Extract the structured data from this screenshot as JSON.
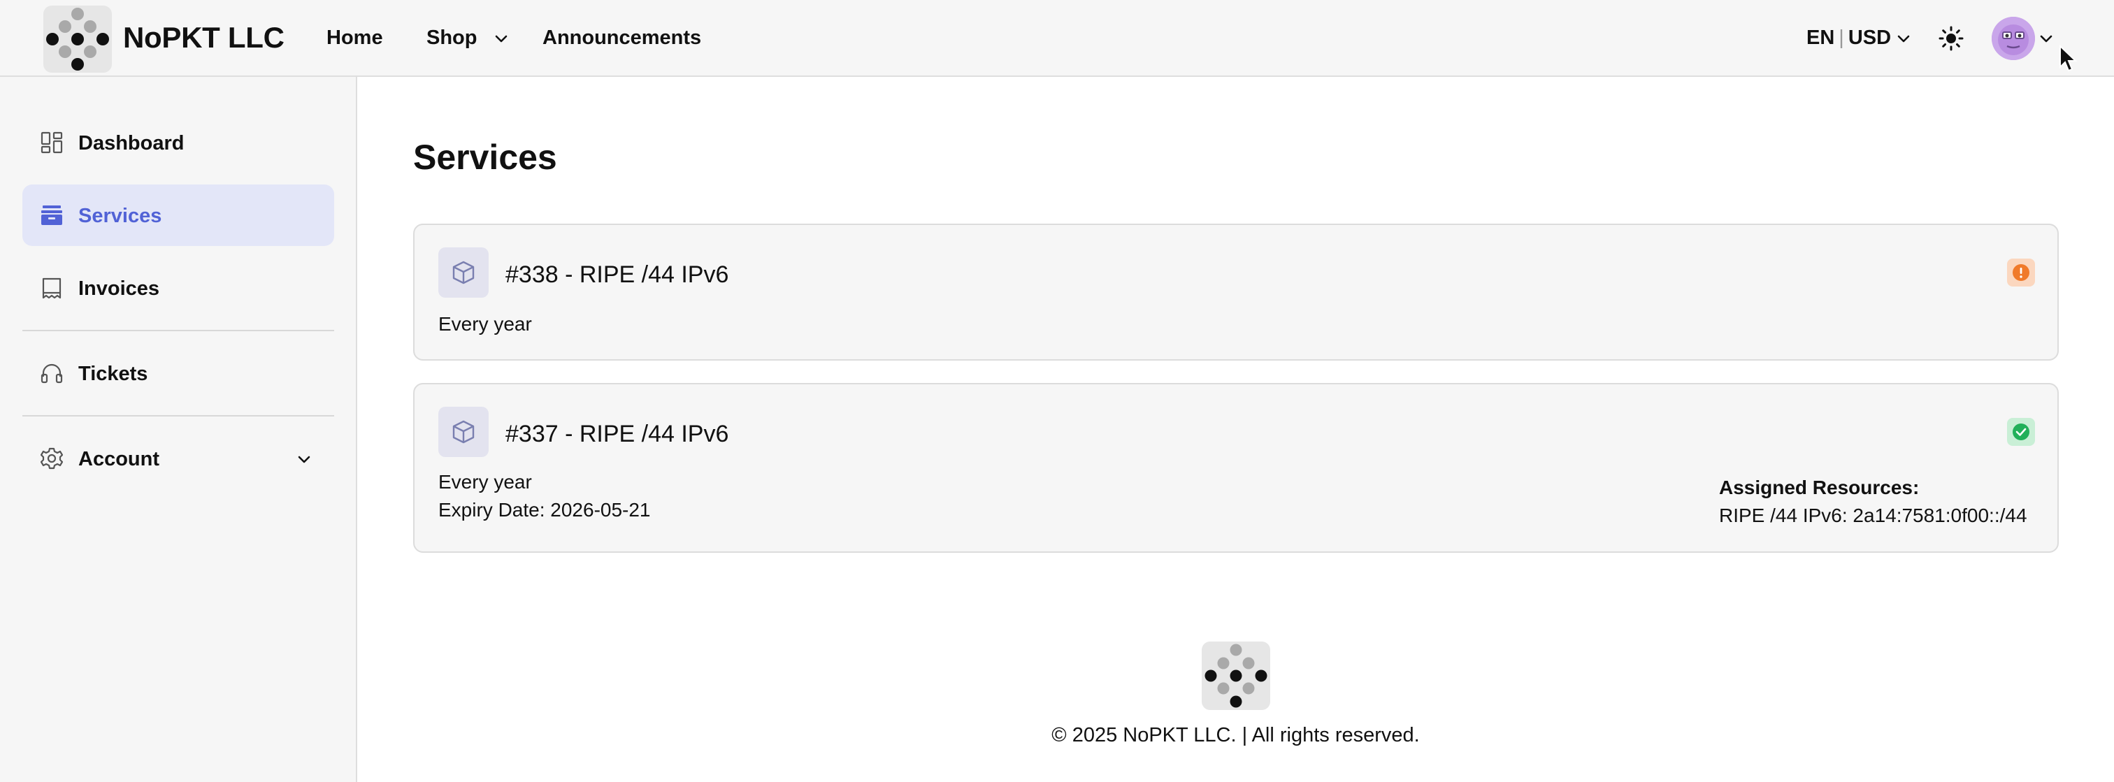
{
  "header": {
    "brand": "NoPKT LLC",
    "nav": {
      "home": "Home",
      "shop": "Shop",
      "announcements": "Announcements"
    },
    "language": "EN",
    "currency": "USD",
    "theme_icon": "sun-icon",
    "avatar_icon": "user-avatar"
  },
  "sidebar": {
    "items": [
      {
        "label": "Dashboard",
        "icon": "dashboard-icon"
      },
      {
        "label": "Services",
        "icon": "services-icon",
        "active": true
      },
      {
        "label": "Invoices",
        "icon": "invoices-icon"
      },
      {
        "label": "Tickets",
        "icon": "headset-icon"
      },
      {
        "label": "Account",
        "icon": "gear-icon"
      }
    ]
  },
  "main": {
    "title": "Services",
    "services": [
      {
        "title": "#338 - RIPE /44 IPv6",
        "billing": "Every year",
        "status": "warning",
        "status_color": "#f07a2a"
      },
      {
        "title": "#337 - RIPE /44 IPv6",
        "billing": "Every year",
        "expiry": "Expiry Date: 2026-05-21",
        "status": "active",
        "status_color": "#22b05a",
        "resources_label": "Assigned Resources:",
        "resources_value": "RIPE /44 IPv6: 2a14:7581:0f00::/44"
      }
    ]
  },
  "footer": {
    "copyright": "© 2025 NoPKT LLC. | All rights reserved."
  },
  "colors": {
    "accent": "#5162d6",
    "active_bg": "#e3e6f8",
    "panel_bg": "#f6f6f6"
  }
}
